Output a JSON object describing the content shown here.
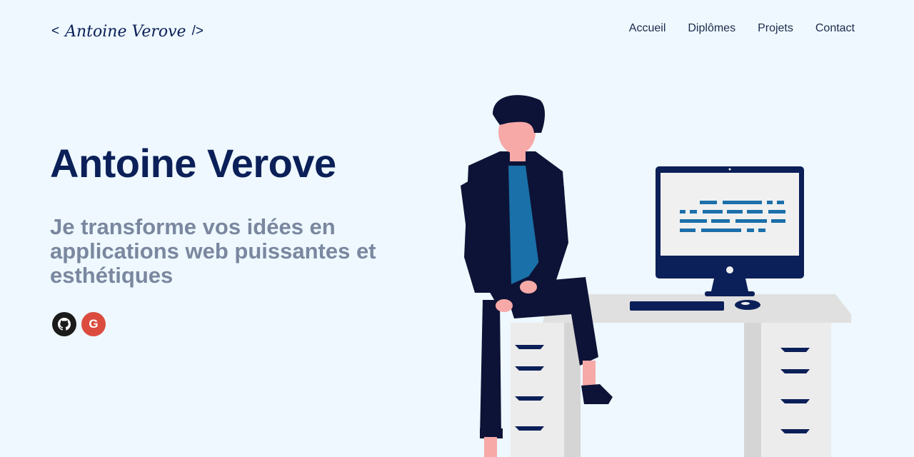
{
  "header": {
    "logo": {
      "open": "<",
      "name": "Antoine Verove",
      "close": "/>"
    },
    "nav": [
      {
        "label": "Accueil"
      },
      {
        "label": "Diplômes"
      },
      {
        "label": "Projets"
      },
      {
        "label": "Contact"
      }
    ]
  },
  "hero": {
    "title": "Antoine Verove",
    "tagline": "Je transforme vos idées en applications web puissantes et esthétiques",
    "socials": [
      {
        "icon": "github-icon",
        "color": "#1b1b1b"
      },
      {
        "icon": "google-icon",
        "letter": "G",
        "color": "#db4c3f"
      }
    ]
  },
  "colors": {
    "background": "#eef8fe",
    "primary": "#0b1f58",
    "muted": "#7a879f"
  }
}
